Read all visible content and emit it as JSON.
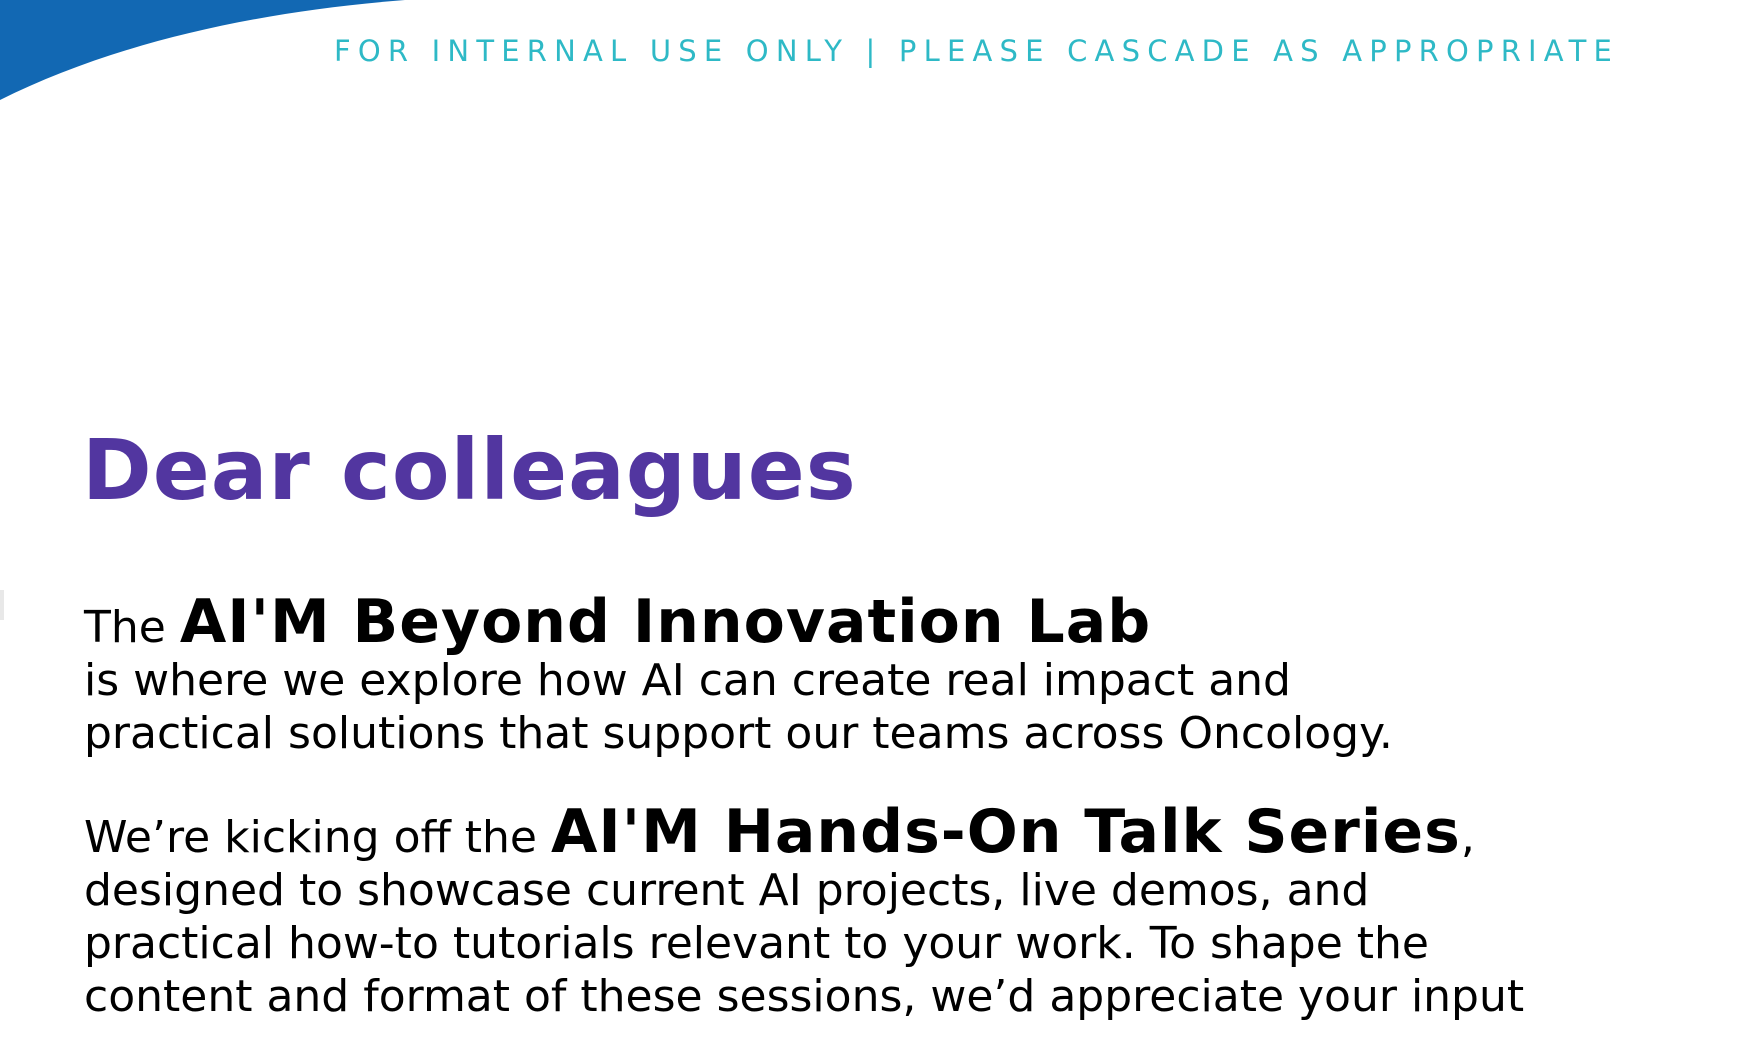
{
  "header": {
    "banner": "FOR INTERNAL USE ONLY | PLEASE CASCADE AS APPROPRIATE",
    "swoosh_color": "#1268B3",
    "banner_color": "#2EB9C6"
  },
  "letter": {
    "greeting": "Dear colleagues",
    "greeting_color": "#5236A0",
    "paragraph1": {
      "lead": "The ",
      "brand": "AI'M Beyond Innovation Lab",
      "line2": "is where we explore how AI can create real impact and",
      "line3": "practical solutions that support our teams across Oncology."
    },
    "paragraph2": {
      "lead": "We’re kicking off the ",
      "brand": "AI'M Hands-On Talk Series",
      "trail": ",",
      "line2": "designed to showcase current AI projects, live demos, and",
      "line3": "practical how-to tutorials relevant to your work. To shape the",
      "line4": "content and format of these sessions, we’d appreciate your input"
    }
  }
}
